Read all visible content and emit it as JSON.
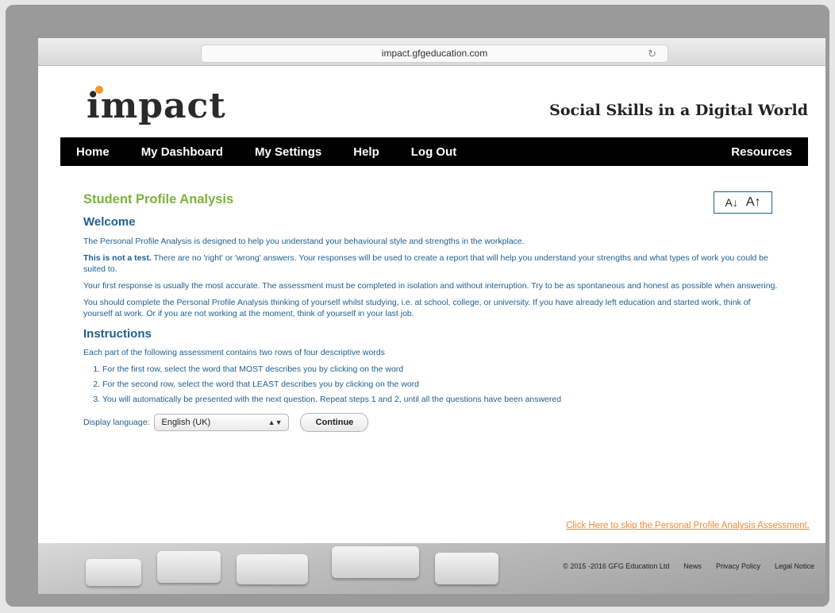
{
  "browser": {
    "url": "impact.gfgeducation.com",
    "reload_icon": "↻"
  },
  "brand": {
    "logo": "impact",
    "tagline": "Social Skills in a Digital World",
    "accent": "#f39a1e"
  },
  "nav": {
    "items": [
      "Home",
      "My Dashboard",
      "My Settings",
      "Help",
      "Log Out"
    ],
    "right": "Resources"
  },
  "font_controls": {
    "decrease": "A↓",
    "increase": "A↑"
  },
  "page": {
    "title": "Student Profile Analysis",
    "welcome_heading": "Welcome",
    "para1": "The Personal Profile Analysis is designed to help you understand your behavioural style and strengths in the workplace.",
    "para2_bold": "This is not a test.",
    "para2_rest": " There are no 'right' or 'wrong' answers. Your responses will be used to create a report that will help you understand your strengths and what types of work you could be suited to.",
    "para3": "Your first response is usually the most accurate. The assessment must be completed in isolation and without interruption. Try to be as spontaneous and honest as possible when answering.",
    "para4": "You should complete the Personal Profile Analysis thinking of yourself whilst studying, i.e. at school, college, or university. If you have already left education and started work, think of yourself at work. Or if you are not working at the moment, think of yourself in your last job.",
    "instructions_heading": "Instructions",
    "instructions_intro": "Each part of the following assessment contains two rows of four descriptive words",
    "steps": [
      "For the first row, select the word that MOST describes you by clicking on the word",
      "For the second row, select the word that LEAST describes you by clicking on the word",
      "You will automatically be presented with the next question. Repeat steps 1 and 2, until all the questions have been answered"
    ],
    "language_label": "Display language:",
    "language_value": "English (UK)",
    "continue_label": "Continue",
    "skip_link": "Click Here to skip the Personal Profile Analysis Assessment."
  },
  "footer": {
    "copyright": "© 2015 -2016 GFG Education Ltd",
    "links": [
      "News",
      "Privacy Policy",
      "Legal Notice"
    ]
  },
  "colors": {
    "title_green": "#7bb33b",
    "text_blue": "#1f5f8f",
    "skip_orange": "#f08a3a"
  }
}
